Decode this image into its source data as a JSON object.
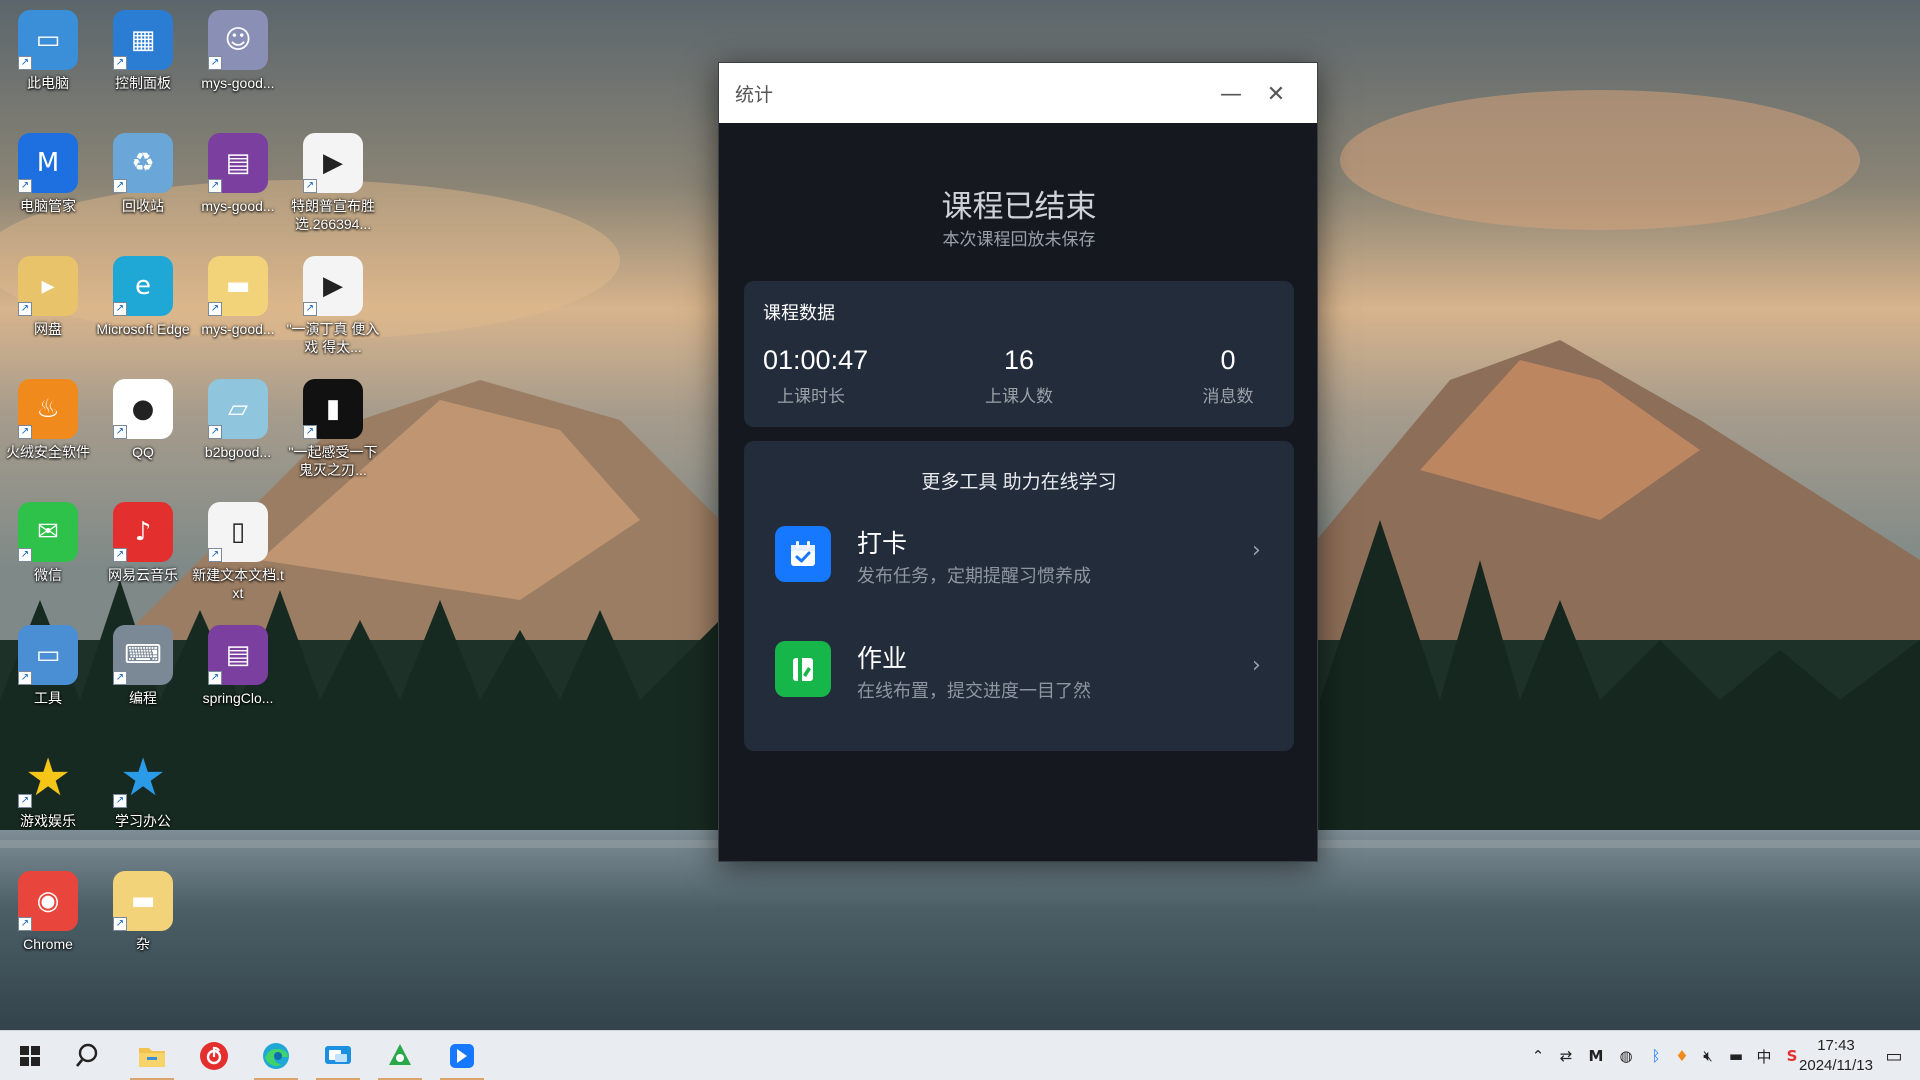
{
  "desktop": {
    "icons": [
      {
        "label": "此电脑",
        "icon": "computer-icon",
        "color": "#3a8fd8"
      },
      {
        "label": "控制面板",
        "icon": "control-panel-icon",
        "color": "#2b7cd3"
      },
      {
        "label": "mys-good...",
        "icon": "anime-avatar-icon",
        "color": "#8a8fb5"
      },
      {
        "label": "电脑管家",
        "icon": "pc-manager-icon",
        "color": "#1e6fe0"
      },
      {
        "label": "回收站",
        "icon": "recycle-bin-icon",
        "color": "#6aa7d8"
      },
      {
        "label": "mys-good...",
        "icon": "winrar-icon",
        "color": "#7b3fa0"
      },
      {
        "label": "特朗普宣布胜选.266394...",
        "icon": "video-file-icon",
        "color": "#f4f4f4"
      },
      {
        "label": "网盘",
        "icon": "netdisk-icon",
        "color": "#e8c36a"
      },
      {
        "label": "Microsoft Edge",
        "icon": "edge-icon",
        "color": "#1fa8d6"
      },
      {
        "label": "mys-good...",
        "icon": "folder-icon",
        "color": "#f3d37a"
      },
      {
        "label": "\"一演丁真 便入戏 得太...",
        "icon": "video-file-icon",
        "color": "#f4f4f4"
      },
      {
        "label": "火绒安全软件",
        "icon": "huorong-icon",
        "color": "#f08a1c"
      },
      {
        "label": "QQ",
        "icon": "qq-icon",
        "color": "#ffffff"
      },
      {
        "label": "b2bgood...",
        "icon": "notepad-icon",
        "color": "#8fc6dd"
      },
      {
        "label": "\"一起感受一下鬼灭之刃...",
        "icon": "film-icon",
        "color": "#111111"
      },
      {
        "label": "微信",
        "icon": "wechat-icon",
        "color": "#2ec24b"
      },
      {
        "label": "网易云音乐",
        "icon": "netease-music-icon",
        "color": "#e3302f"
      },
      {
        "label": "新建文本文档.txt",
        "icon": "text-file-icon",
        "color": "#f4f4f4"
      },
      {
        "label": "工具",
        "icon": "tools-icon",
        "color": "#4a8fd3"
      },
      {
        "label": "编程",
        "icon": "programming-icon",
        "color": "#7b8896"
      },
      {
        "label": "springClo...",
        "icon": "winrar-icon",
        "color": "#7b3fa0"
      },
      {
        "label": "游戏娱乐",
        "icon": "star-icon",
        "color": "#f5c518"
      },
      {
        "label": "学习办公",
        "icon": "blue-star-icon",
        "color": "#2b9be8"
      },
      {
        "label": "Chrome",
        "icon": "chrome-icon",
        "color": "#e8453c"
      },
      {
        "label": "杂",
        "icon": "folder-icon",
        "color": "#f3d37a"
      }
    ]
  },
  "dialog": {
    "title": "统计",
    "minimize_symbol": "—",
    "close_symbol": "✕",
    "heading": "课程已结束",
    "subheading": "本次课程回放未保存",
    "stats": {
      "title": "课程数据",
      "duration": {
        "value": "01:00:47",
        "label": "上课时长"
      },
      "attendees": {
        "value": "16",
        "label": "上课人数"
      },
      "messages": {
        "value": "0",
        "label": "消息数"
      }
    },
    "tools": {
      "heading": "更多工具 助力在线学习",
      "items": [
        {
          "name": "打卡",
          "desc": "发布任务，定期提醒习惯养成",
          "icon": "checkin-calendar-icon",
          "color": "#1677ff"
        },
        {
          "name": "作业",
          "desc": "在线布置，提交进度一目了然",
          "icon": "homework-icon",
          "color": "#16b64a"
        }
      ],
      "arrow": "›"
    }
  },
  "taskbar": {
    "apps": [
      {
        "icon": "start-windows-icon"
      },
      {
        "icon": "search-icon"
      },
      {
        "icon": "file-explorer-icon"
      },
      {
        "icon": "netease-music-icon"
      },
      {
        "icon": "edge-icon"
      },
      {
        "icon": "remote-desktop-icon"
      },
      {
        "icon": "green-app-icon"
      },
      {
        "icon": "netdisk-icon"
      }
    ],
    "clock": {
      "time": "17:43",
      "date": "2024/11/13"
    }
  }
}
